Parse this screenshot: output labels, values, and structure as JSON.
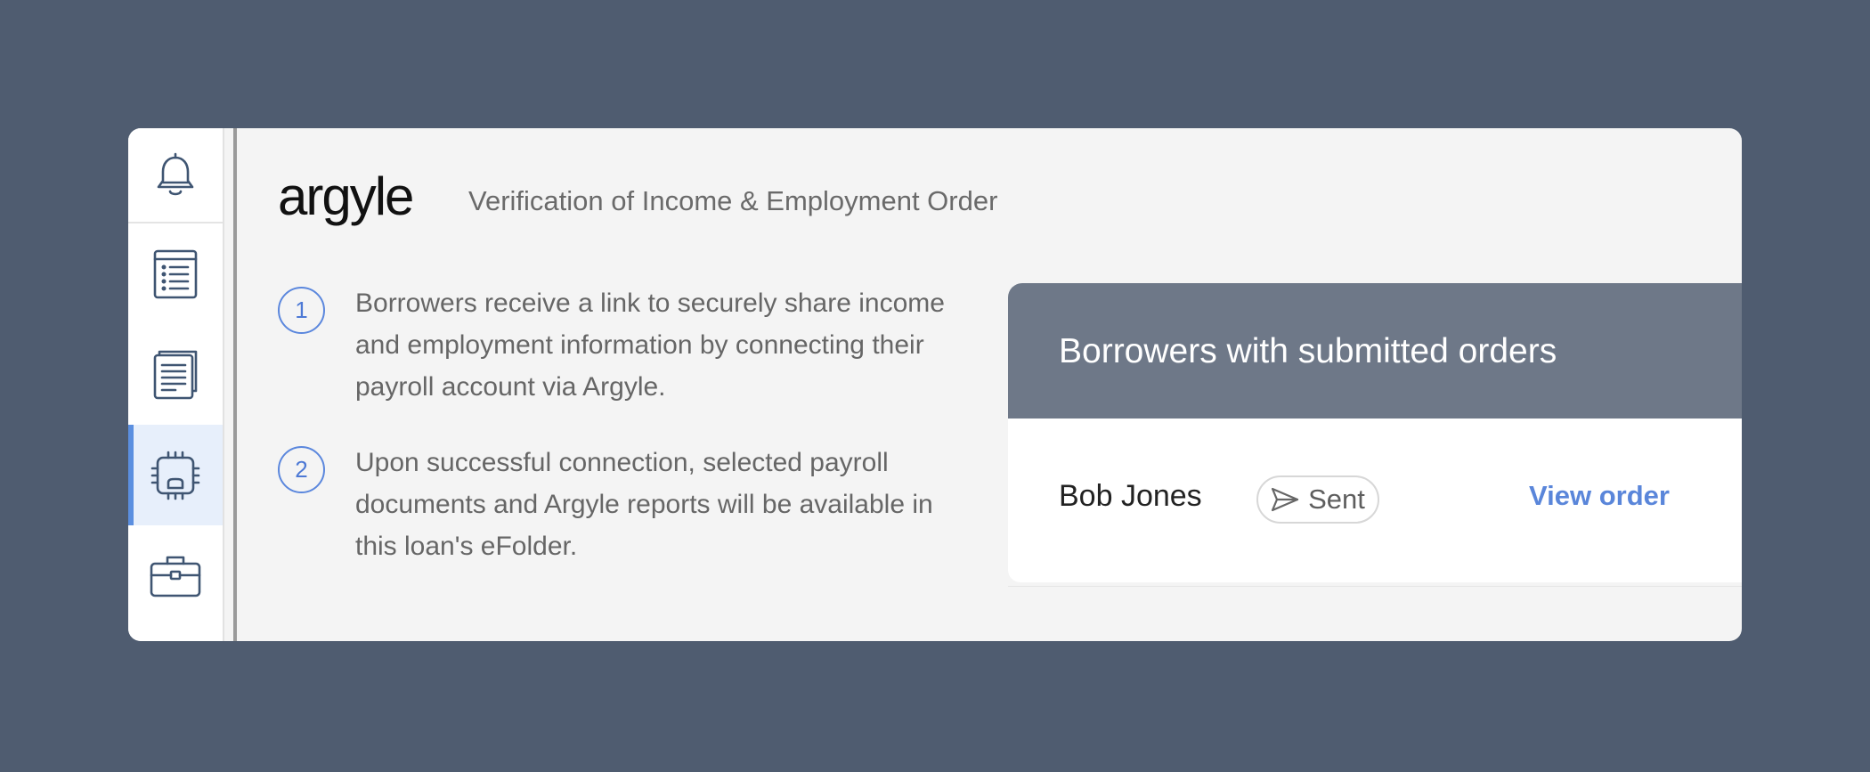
{
  "sidebar": {
    "items": [
      {
        "icon": "bell-icon",
        "active": false
      },
      {
        "icon": "checklist-document-icon",
        "active": false
      },
      {
        "icon": "stacked-documents-icon",
        "active": false
      },
      {
        "icon": "chip-icon",
        "active": true
      },
      {
        "icon": "briefcase-icon",
        "active": false
      }
    ]
  },
  "header": {
    "logo_text": "argyle",
    "title": "Verification of Income & Employment Order"
  },
  "steps": [
    {
      "number": "1",
      "text": "Borrowers receive a link to securely share income and employment information by connecting their payroll account via Argyle."
    },
    {
      "number": "2",
      "text": "Upon successful connection, selected payroll documents and Argyle reports will be available in this loan's eFolder."
    }
  ],
  "orders": {
    "title": "Borrowers with submitted orders",
    "rows": [
      {
        "name": "Bob Jones",
        "status": "Sent",
        "status_icon": "paper-plane-icon",
        "action": "View order"
      }
    ]
  },
  "colors": {
    "background": "#4f5c70",
    "accent": "#5b87dd",
    "panel_header": "#6e7888",
    "active_sidebar": "#e7effb"
  }
}
